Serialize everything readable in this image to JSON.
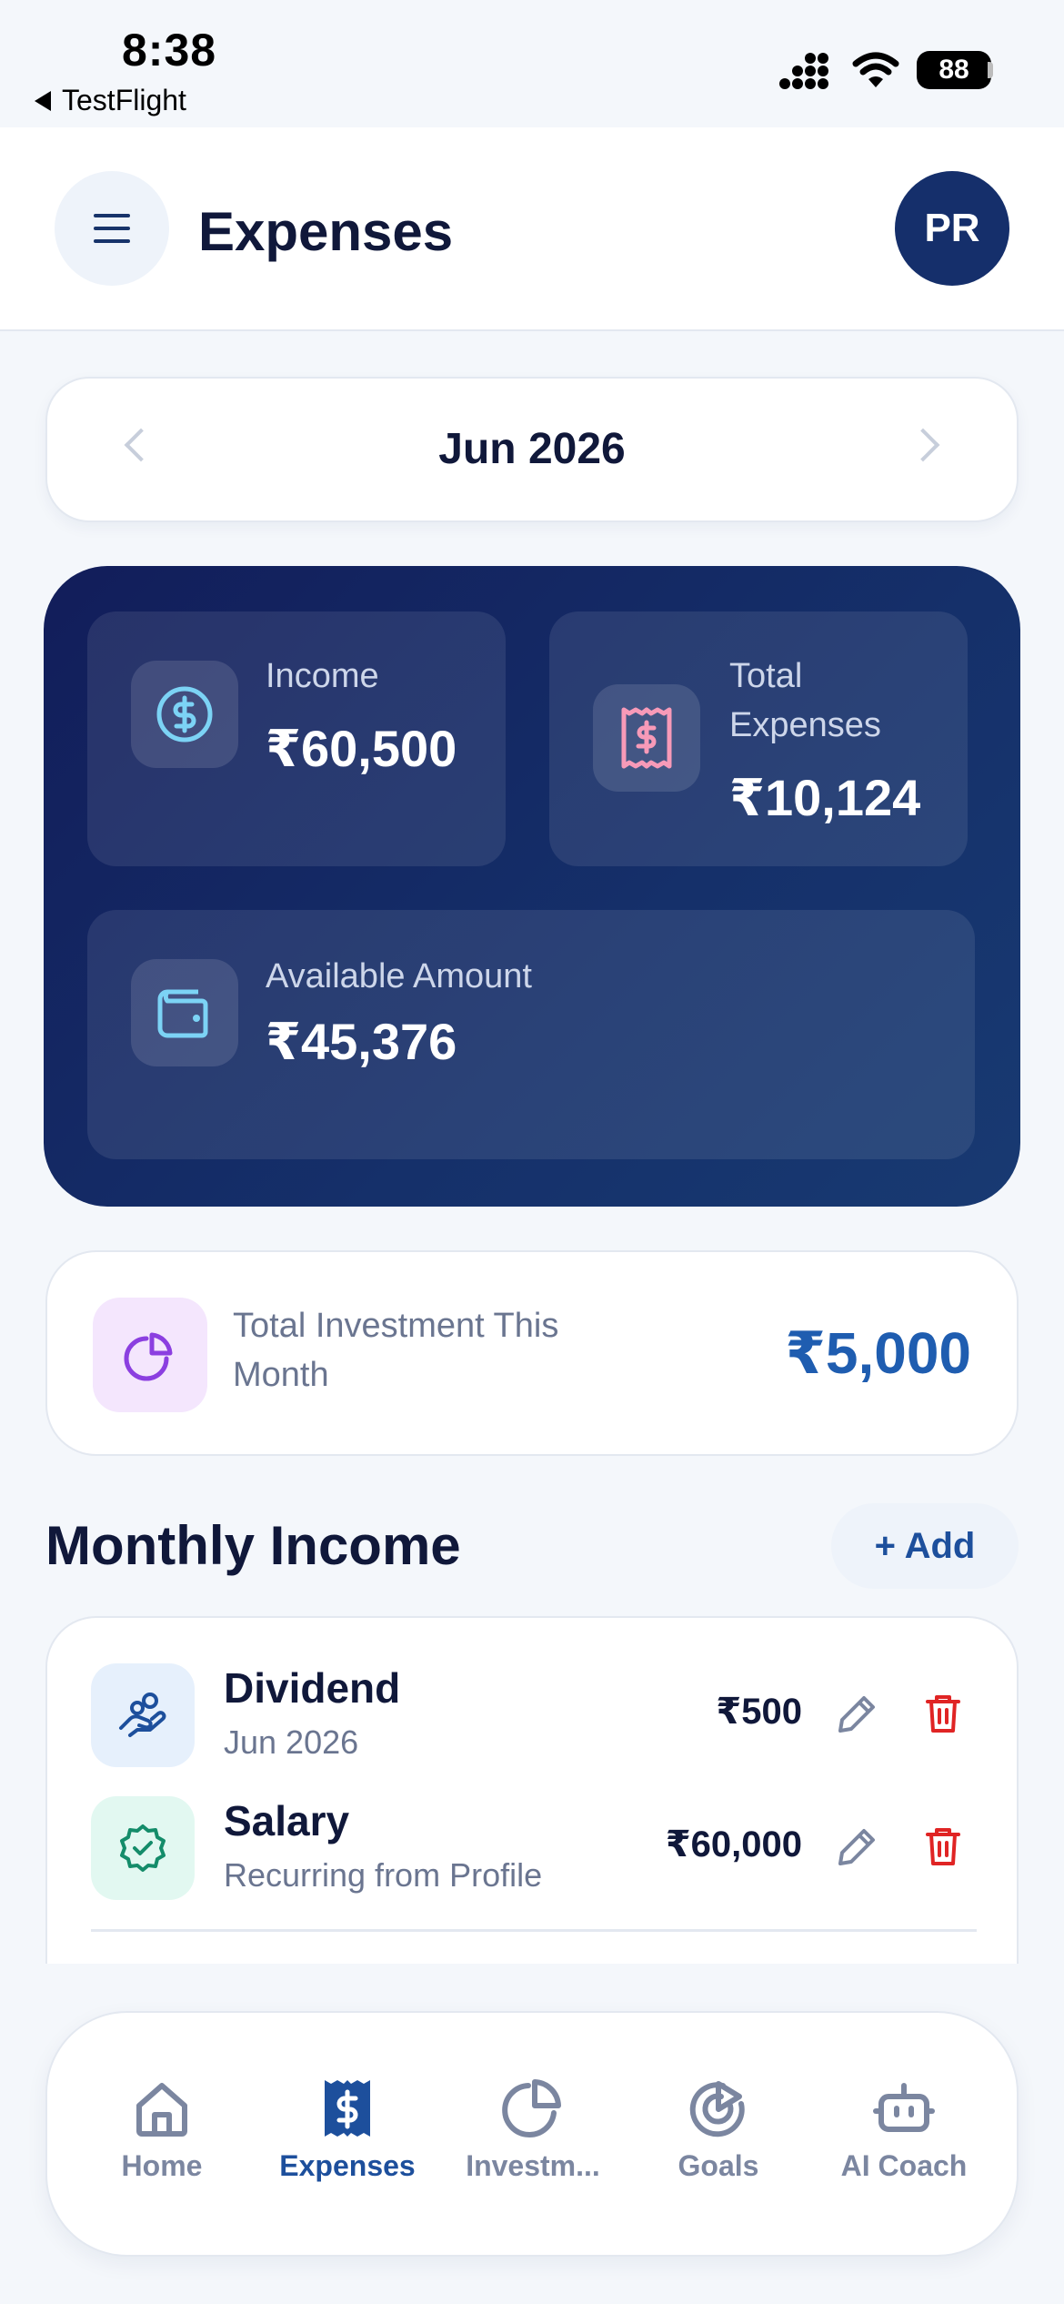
{
  "status_bar": {
    "time": "8:38",
    "back_app": "TestFlight",
    "battery": "88"
  },
  "header": {
    "title": "Expenses",
    "avatar_initials": "PR"
  },
  "month_selector": {
    "label": "Jun 2026"
  },
  "summary": {
    "income": {
      "label": "Income",
      "value": "₹60,500"
    },
    "total_expenses": {
      "label_line1": "Total",
      "label_line2": "Expenses",
      "value": "₹10,124"
    },
    "available": {
      "label": "Available Amount",
      "value": "₹45,376"
    }
  },
  "investment": {
    "label": "Total Investment This Month",
    "value": "₹5,000"
  },
  "monthly_income": {
    "title": "Monthly Income",
    "add_label": "+ Add",
    "rows": [
      {
        "name": "Dividend",
        "sub": "Jun 2026",
        "amount": "₹500",
        "icon": "hand-coins-icon"
      },
      {
        "name": "Salary",
        "sub": "Recurring from Profile",
        "amount": "₹60,000",
        "icon": "badge-check-icon"
      }
    ]
  },
  "nav": {
    "items": [
      {
        "label": "Home",
        "icon": "home-icon"
      },
      {
        "label": "Expenses",
        "icon": "receipt-icon",
        "active": true
      },
      {
        "label": "Investm...",
        "icon": "pie-chart-icon"
      },
      {
        "label": "Goals",
        "icon": "target-icon"
      },
      {
        "label": "AI Coach",
        "icon": "bot-icon"
      }
    ]
  },
  "colors": {
    "primary": "#152f6b",
    "accent": "#1d4f9c",
    "danger": "#e02424",
    "background": "#f4f7fb"
  }
}
